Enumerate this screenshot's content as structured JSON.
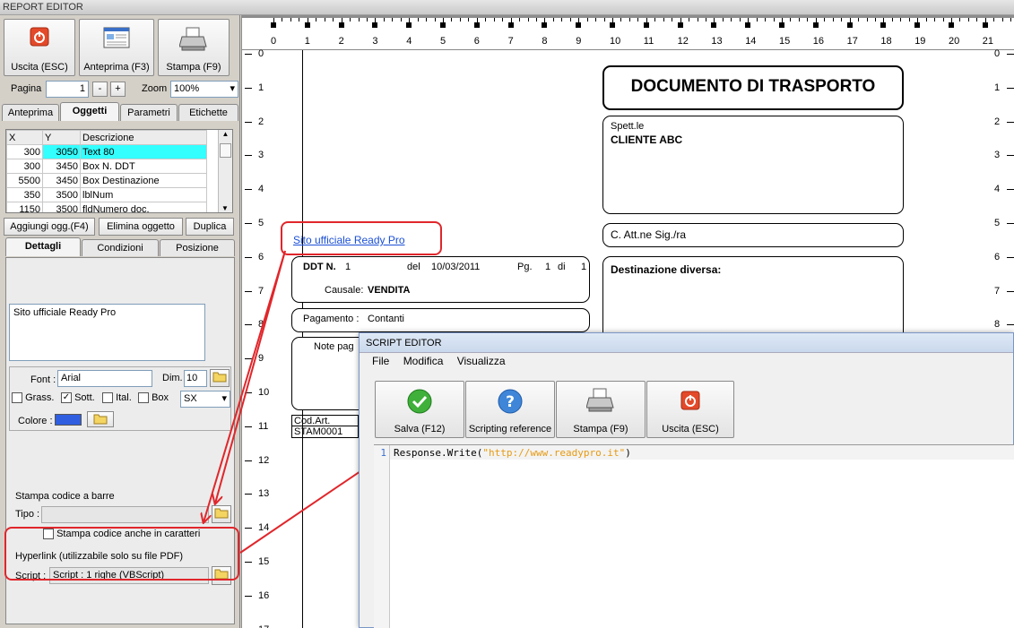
{
  "window": {
    "title": "REPORT EDITOR"
  },
  "toolbar": {
    "exit": "Uscita (ESC)",
    "preview": "Anteprima (F3)",
    "print": "Stampa (F9)"
  },
  "pager": {
    "label": "Pagina",
    "value": "1",
    "minus": "-",
    "plus": "+",
    "zoom_label": "Zoom",
    "zoom_value": "100%"
  },
  "tabs": {
    "items": [
      "Anteprima",
      "Oggetti",
      "Parametri",
      "Etichette"
    ],
    "active": "Oggetti"
  },
  "objects": {
    "headers": [
      "X",
      "Y",
      "Descrizione"
    ],
    "rows": [
      {
        "x": "300",
        "y": "3050",
        "desc": "Text 80"
      },
      {
        "x": "300",
        "y": "3450",
        "desc": "Box N. DDT"
      },
      {
        "x": "5500",
        "y": "3450",
        "desc": "Box Destinazione"
      },
      {
        "x": "350",
        "y": "3500",
        "desc": "lblNum"
      },
      {
        "x": "1150",
        "y": "3500",
        "desc": "fldNumero doc."
      }
    ],
    "selected_row": 0
  },
  "object_buttons": {
    "add": "Aggiungi ogg.(F4)",
    "delete": "Elimina oggetto",
    "duplicate": "Duplica"
  },
  "subtabs": {
    "items": [
      "Dettagli",
      "Condizioni",
      "Posizione"
    ],
    "active": "Dettagli"
  },
  "details": {
    "text_value": "Sito ufficiale Ready Pro",
    "font_label": "Font :",
    "font_value": "Arial",
    "size_label": "Dim.",
    "size_value": "10",
    "bold_label": "Grass.",
    "underline_label": "Sott.",
    "italic_label": "Ital.",
    "box_label": "Box",
    "align_value": "SX",
    "color_label": "Colore :",
    "color_value": "#2f5fe0"
  },
  "barcode": {
    "title": "Stampa codice a barre",
    "type_label": "Tipo :",
    "chars_label": "Stampa codice anche in caratteri"
  },
  "hyperlink": {
    "title": "Hyperlink (utilizzabile solo su file PDF)",
    "script_label": "Script :",
    "script_value": "Script : 1 righe (VBScript)"
  },
  "ruler": {
    "h_labels": [
      "0",
      "1",
      "2",
      "3",
      "4",
      "5",
      "6",
      "7",
      "8",
      "9",
      "10",
      "11",
      "12",
      "13",
      "14",
      "15",
      "16",
      "17",
      "18",
      "19",
      "20",
      "21"
    ],
    "v_labels": [
      "0",
      "1",
      "2",
      "3",
      "4",
      "5",
      "6",
      "7",
      "8",
      "9",
      "10",
      "11",
      "12",
      "13",
      "14",
      "15",
      "16",
      "17"
    ]
  },
  "document": {
    "title": "DOCUMENTO DI TRASPORTO",
    "spett": "Spett.le",
    "client": "CLIENTE ABC",
    "att": "C. Att.ne Sig./ra",
    "dest": "Destinazione diversa:",
    "link": "Sito ufficiale Ready Pro",
    "ddt_label": "DDT N.",
    "ddt_num": "1",
    "del_label": "del",
    "date": "10/03/2011",
    "pg_label": "Pg.",
    "pg_num": "1",
    "di_label": "di",
    "pg_total": "1",
    "causale_label": "Causale:",
    "causale": "VENDITA",
    "pagamento_label": "Pagamento :",
    "pagamento": "Contanti",
    "note_label": "Note pag",
    "cod_header": "Cod.Art.",
    "cod_row": "STAM0001"
  },
  "script_editor": {
    "title": "SCRIPT EDITOR",
    "menu": [
      "File",
      "Modifica",
      "Visualizza"
    ],
    "save": "Salva (F12)",
    "reference": "Scripting reference",
    "print": "Stampa (F9)",
    "exit": "Uscita (ESC)",
    "line_no": "1",
    "code_prefix": "Response.Write(",
    "code_string": "\"http://www.readypro.it\"",
    "code_suffix": ")"
  },
  "colors": {
    "annotation": "#e0262b",
    "selection": "#33ffff",
    "link": "#1a4fd6"
  }
}
